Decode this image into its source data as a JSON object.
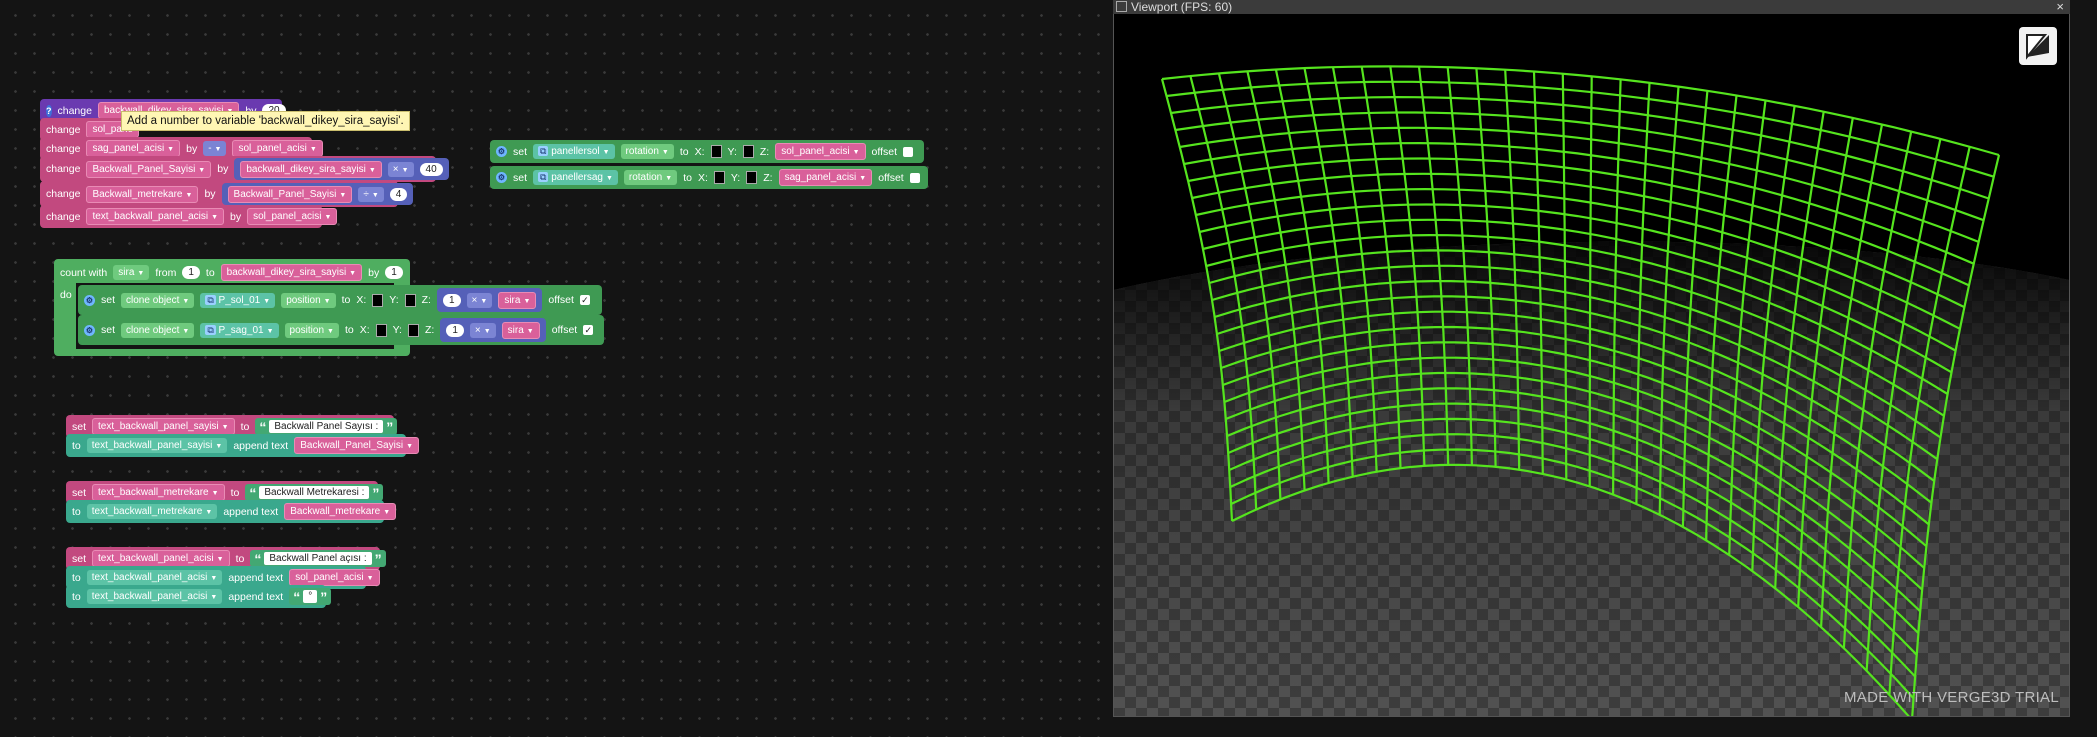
{
  "workspace": {
    "change_group": {
      "r1": {
        "kw": "change",
        "var": "backwall_dikey_sira_sayisi",
        "by": "by",
        "num": "20"
      },
      "r2": {
        "kw": "change",
        "var": "sol_pane"
      },
      "r3": {
        "kw": "change",
        "var": "sag_panel_acisi",
        "by": "by",
        "op": "-",
        "var2": "sol_panel_acisi"
      },
      "r4": {
        "kw": "change",
        "var": "Backwall_Panel_Sayisi",
        "by": "by",
        "var2": "backwall_dikey_sira_sayisi",
        "op": "×",
        "num": "40"
      },
      "r5": {
        "kw": "change",
        "var": "Backwall_metrekare",
        "by": "by",
        "var2": "Backwall_Panel_Sayisi",
        "op": "÷",
        "num": "4"
      },
      "r6": {
        "kw": "change",
        "var": "text_backwall_panel_acisi",
        "by": "by",
        "var2": "sol_panel_acisi"
      }
    },
    "tooltip": "Add a number to variable 'backwall_dikey_sira_sayisi'.",
    "rotation_group": {
      "r1": {
        "kw": "set",
        "obj": "panellersol",
        "prop": "rotation",
        "to": "to",
        "x": "X:",
        "y": "Y:",
        "z": "Z:",
        "var": "sol_panel_acisi",
        "offset": "offset"
      },
      "r2": {
        "kw": "set",
        "obj": "panellersag",
        "prop": "rotation",
        "to": "to",
        "x": "X:",
        "y": "Y:",
        "z": "Z:",
        "var": "sag_panel_acisi",
        "offset": "offset"
      }
    },
    "loop": {
      "count_with": "count with",
      "var": "sira",
      "from": "from",
      "from_val": "1",
      "to": "to",
      "to_var": "backwall_dikey_sira_sayisi",
      "by": "by",
      "by_val": "1",
      "do": "do",
      "r1": {
        "kw": "set",
        "clone": "clone object",
        "obj": "P_sol_01",
        "prop": "position",
        "to": "to",
        "x": "X:",
        "y": "Y:",
        "z": "Z:",
        "num": "1",
        "op": "×",
        "var": "sira",
        "offset": "offset",
        "check": "✓"
      },
      "r2": {
        "kw": "set",
        "clone": "clone object",
        "obj": "P_sag_01",
        "prop": "position",
        "to": "to",
        "x": "X:",
        "y": "Y:",
        "z": "Z:",
        "num": "1",
        "op": "×",
        "var": "sira",
        "offset": "offset",
        "check": "✓"
      }
    },
    "text_group1": {
      "r1": {
        "kw": "set",
        "var": "text_backwall_panel_sayisi",
        "to": "to",
        "str": "Backwall Panel Sayısı :"
      },
      "r2": {
        "kw": "to",
        "var": "text_backwall_panel_sayisi",
        "append": "append text",
        "var2": "Backwall_Panel_Sayisi"
      }
    },
    "text_group2": {
      "r1": {
        "kw": "set",
        "var": "text_backwall_metrekare",
        "to": "to",
        "str": "Backwall Metrekaresi :"
      },
      "r2": {
        "kw": "to",
        "var": "text_backwall_metrekare",
        "append": "append text",
        "var2": "Backwall_metrekare"
      }
    },
    "text_group3": {
      "r1": {
        "kw": "set",
        "var": "text_backwall_panel_acisi",
        "to": "to",
        "str": "Backwall Panel açısı :"
      },
      "r2": {
        "kw": "to",
        "var": "text_backwall_panel_acisi",
        "append": "append text",
        "var2": "sol_panel_acisi"
      },
      "r3": {
        "kw": "to",
        "var": "text_backwall_panel_acisi",
        "append": "append text",
        "str": "°"
      }
    }
  },
  "viewport": {
    "title": "Viewport (FPS: 60)",
    "close": "×",
    "watermark": "MADE WITH VERGE3D TRIAL"
  },
  "colors": {
    "grid": "#55e41e",
    "floor": "#4a4a4a"
  }
}
